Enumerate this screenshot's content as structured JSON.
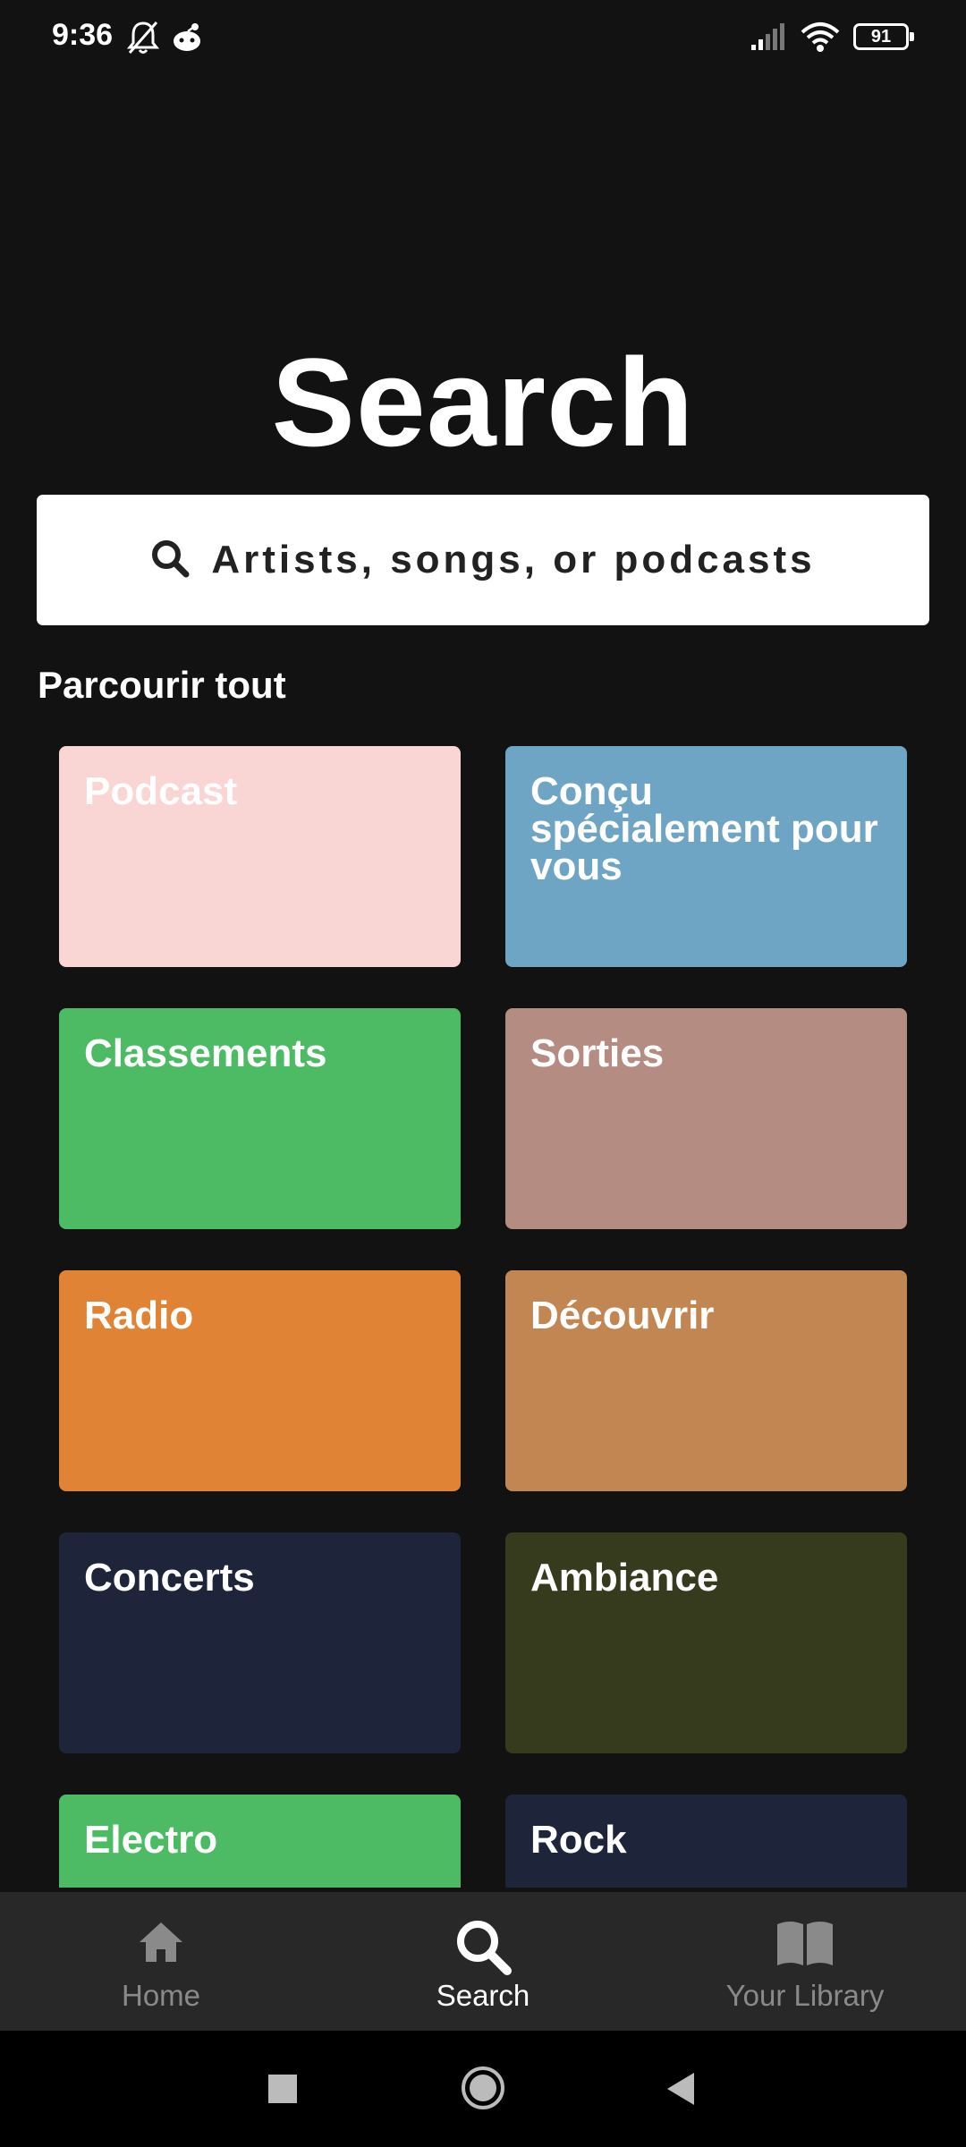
{
  "status_bar": {
    "time": "9:36",
    "battery": "91",
    "icons": [
      "mute-bell-icon",
      "reddit-icon",
      "signal-icon",
      "wifi-icon",
      "battery-icon"
    ]
  },
  "page_title": "Search",
  "search": {
    "placeholder": "Artists, songs, or podcasts",
    "icon": "search-icon"
  },
  "section_title": "Parcourir tout",
  "tiles": [
    {
      "label": "Podcast",
      "color": "#F9D5D4"
    },
    {
      "label": "Conçu spécialement pour vous",
      "color": "#6FA5C4"
    },
    {
      "label": "Classements",
      "color": "#4CBB63"
    },
    {
      "label": "Sorties",
      "color": "#B48C81"
    },
    {
      "label": "Radio",
      "color": "#E08334"
    },
    {
      "label": "Découvrir",
      "color": "#C28652"
    },
    {
      "label": "Concerts",
      "color": "#1E253A"
    },
    {
      "label": "Ambiance",
      "color": "#353B1C"
    },
    {
      "label": "Electro",
      "color": "#4CBB63"
    },
    {
      "label": "Rock",
      "color": "#1E253A"
    }
  ],
  "bottom_nav": [
    {
      "label": "Home",
      "icon": "home-icon",
      "active": false
    },
    {
      "label": "Search",
      "icon": "search-icon",
      "active": true
    },
    {
      "label": "Your Library",
      "icon": "library-icon",
      "active": false
    }
  ],
  "system_nav": [
    "recents-square-icon",
    "home-circle-icon",
    "back-triangle-icon"
  ],
  "colors": {
    "background": "#121212",
    "nav_bg": "#282828",
    "inactive": "#8A8A8A",
    "active": "#FFFFFF"
  }
}
